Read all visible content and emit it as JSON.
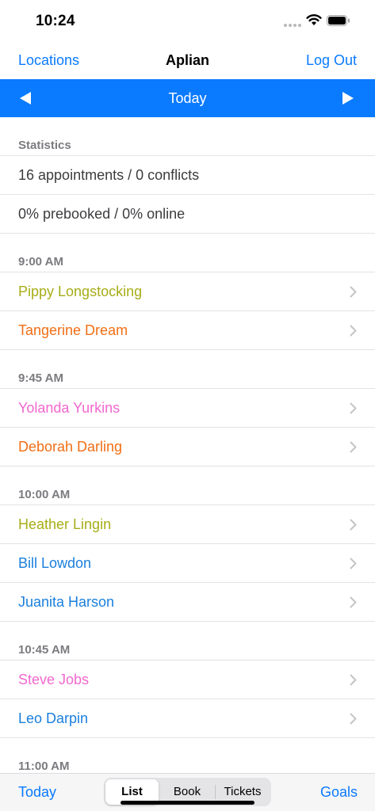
{
  "status_bar": {
    "time": "10:24"
  },
  "nav": {
    "left": "Locations",
    "title": "Aplian",
    "right": "Log Out"
  },
  "date_bar": {
    "label": "Today",
    "color": "#0a7aff"
  },
  "statistics": {
    "header": "Statistics",
    "rows": [
      "16 appointments / 0 conflicts",
      "0% prebooked / 0% online"
    ]
  },
  "sections": [
    {
      "time": "9:00 AM",
      "items": [
        {
          "name": "Pippy Longstocking",
          "color": "#a6ad16"
        },
        {
          "name": "Tangerine Dream",
          "color": "#f16e16"
        }
      ]
    },
    {
      "time": "9:45 AM",
      "items": [
        {
          "name": "Yolanda Yurkins",
          "color": "#f168cf"
        },
        {
          "name": "Deborah Darling",
          "color": "#f16e16"
        }
      ]
    },
    {
      "time": "10:00 AM",
      "items": [
        {
          "name": "Heather Lingin",
          "color": "#a6ad16"
        },
        {
          "name": "Bill Lowdon",
          "color": "#1a7fdc"
        },
        {
          "name": "Juanita Harson",
          "color": "#1a7fdc"
        }
      ]
    },
    {
      "time": "10:45 AM",
      "items": [
        {
          "name": "Steve Jobs",
          "color": "#f168cf"
        },
        {
          "name": "Leo Darpin",
          "color": "#1a7fdc"
        }
      ]
    },
    {
      "time": "11:00 AM",
      "items": []
    }
  ],
  "tab_bar": {
    "today": "Today",
    "segments": [
      "List",
      "Book",
      "Tickets"
    ],
    "selected_segment": "List",
    "goals": "Goals"
  },
  "icons": {
    "status": [
      "cellular-dots-icon",
      "wifi-icon",
      "battery-icon"
    ],
    "date_prev": "left-triangle-icon",
    "date_next": "right-triangle-icon",
    "row_disclosure": "chevron-right-icon"
  }
}
